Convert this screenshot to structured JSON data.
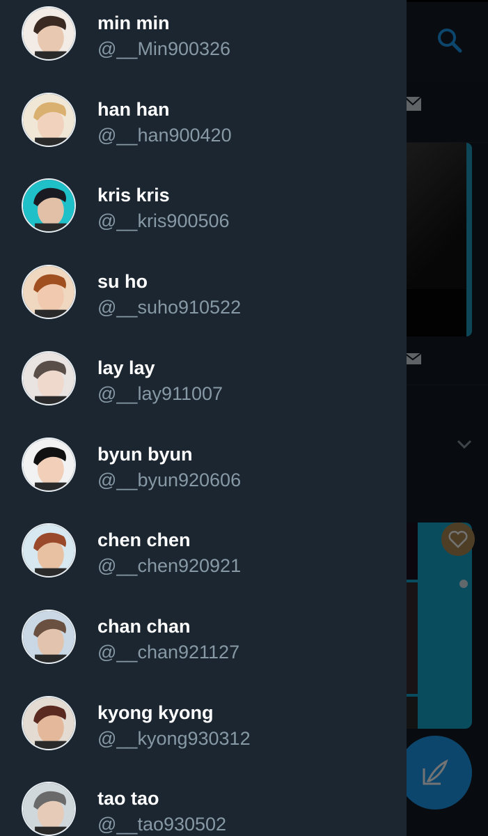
{
  "background": {
    "icons": [
      "search-icon",
      "mail-icon",
      "chevron-down-icon",
      "heart-icon",
      "compose-icon"
    ],
    "accent": "#1d9bf0"
  },
  "drawer": {
    "accounts": [
      {
        "name": "min min",
        "handle": "@__Min900326",
        "avatar": "avatar-1"
      },
      {
        "name": "han han",
        "handle": "@__han900420",
        "avatar": "avatar-2"
      },
      {
        "name": "kris kris",
        "handle": "@__kris900506",
        "avatar": "avatar-3"
      },
      {
        "name": "su ho",
        "handle": "@__suho910522",
        "avatar": "avatar-4"
      },
      {
        "name": "lay lay",
        "handle": "@__lay911007",
        "avatar": "avatar-5"
      },
      {
        "name": "byun byun",
        "handle": "@__byun920606",
        "avatar": "avatar-6"
      },
      {
        "name": "chen chen",
        "handle": "@__chen920921",
        "avatar": "avatar-7"
      },
      {
        "name": "chan chan",
        "handle": "@__chan921127",
        "avatar": "avatar-8"
      },
      {
        "name": "kyong kyong",
        "handle": "@__kyong930312",
        "avatar": "avatar-9"
      },
      {
        "name": "tao tao",
        "handle": "@__tao930502",
        "avatar": "avatar-10"
      }
    ]
  },
  "colors": {
    "drawer_bg": "#1b2631",
    "name_text": "#ffffff",
    "handle_text": "#8899a6"
  }
}
